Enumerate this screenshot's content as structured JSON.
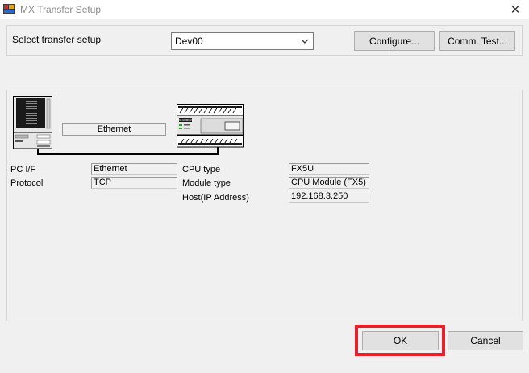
{
  "window": {
    "title": "MX Transfer Setup",
    "close_symbol": "✕"
  },
  "top": {
    "select_label": "Select transfer setup",
    "selected_setup": "Dev00",
    "configure_label": "Configure...",
    "comm_test_label": "Comm. Test..."
  },
  "diagram": {
    "pc_link_label": "Ethernet",
    "plc_brand": "MITSUBISHI"
  },
  "pc_side": {
    "pc_if_label": "PC I/F",
    "pc_if_value": "Ethernet",
    "protocol_label": "Protocol",
    "protocol_value": "TCP"
  },
  "plc_side": {
    "cpu_type_label": "CPU type",
    "cpu_type_value": "FX5U",
    "module_type_label": "Module type",
    "module_type_value": "CPU Module (FX5)",
    "host_label": "Host(IP Address)",
    "host_value": "192.168.3.250"
  },
  "footer": {
    "ok_label": "OK",
    "cancel_label": "Cancel",
    "highlight_color": "#e8202a"
  },
  "icons": [
    "app-icon",
    "close-icon",
    "chevron-down-icon",
    "pc-icon",
    "plc-icon"
  ]
}
